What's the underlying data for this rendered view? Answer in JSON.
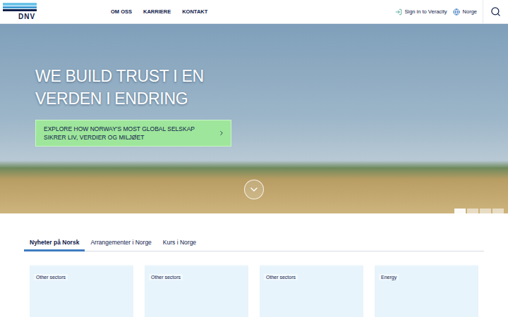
{
  "logo": {
    "text": "DNV"
  },
  "nav": [
    "OM OSS",
    "KARRIERE",
    "KONTAKT"
  ],
  "header_actions": {
    "sign_in": "Sign in to Veracity",
    "region": "Norge"
  },
  "hero": {
    "title_lines": [
      "WE BUILD TRUST I EN",
      "VERDEN I ENDRING"
    ],
    "cta": "EXPLORE HOW NORWAY'S MOST GLOBAL SELSKAP SIKRER LIV, VERDIER OG MILJØET",
    "slides": [
      {
        "selected": true
      },
      {
        "selected": false
      },
      {
        "selected": false
      },
      {
        "selected": false
      }
    ]
  },
  "tabs": [
    {
      "label": "Nyheter på Norsk",
      "selected": true
    },
    {
      "label": "Arrangementer i Norge",
      "selected": false
    },
    {
      "label": "Kurs i Norge",
      "selected": false
    }
  ],
  "cards": [
    {
      "tag": "Other sectors"
    },
    {
      "tag": "Other sectors"
    },
    {
      "tag": "Other sectors"
    },
    {
      "tag": "Energy"
    }
  ]
}
